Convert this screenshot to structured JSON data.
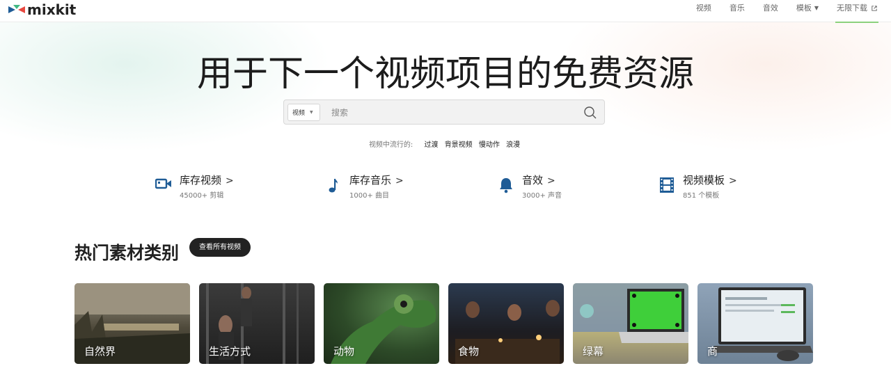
{
  "brand": {
    "name": "mixkit"
  },
  "nav": {
    "items": [
      {
        "label": "视频"
      },
      {
        "label": "音乐"
      },
      {
        "label": "音效"
      },
      {
        "label": "模板",
        "has_dropdown": true
      },
      {
        "label": "无限下载",
        "external": true
      }
    ]
  },
  "hero": {
    "title": "用于下一个视频项目的免费资源"
  },
  "search": {
    "type_selected": "视频",
    "placeholder": "搜索",
    "value": ""
  },
  "trending": {
    "label": "视频中流行的:",
    "tags": [
      "过渡",
      "背景视频",
      "慢动作",
      "浪漫"
    ]
  },
  "categories": [
    {
      "title": "库存视频",
      "subtitle": "45000+ 剪辑",
      "icon": "video-camera-icon"
    },
    {
      "title": "库存音乐",
      "subtitle": "1000+ 曲目",
      "icon": "music-note-icon"
    },
    {
      "title": "音效",
      "subtitle": "3000+ 声音",
      "icon": "bell-icon"
    },
    {
      "title": "视频模板",
      "subtitle": "851 个模板",
      "icon": "film-strip-icon"
    }
  ],
  "popular": {
    "title": "热门素材类别",
    "view_all_label": "查看所有视频",
    "tiles": [
      {
        "label": "自然界"
      },
      {
        "label": "生活方式"
      },
      {
        "label": "动物"
      },
      {
        "label": "食物"
      },
      {
        "label": "绿幕"
      },
      {
        "label": "商"
      }
    ]
  },
  "colors": {
    "accent_blue": "#1f5c96",
    "nav_underline": "#8bd17c",
    "pill_bg": "#222222"
  }
}
